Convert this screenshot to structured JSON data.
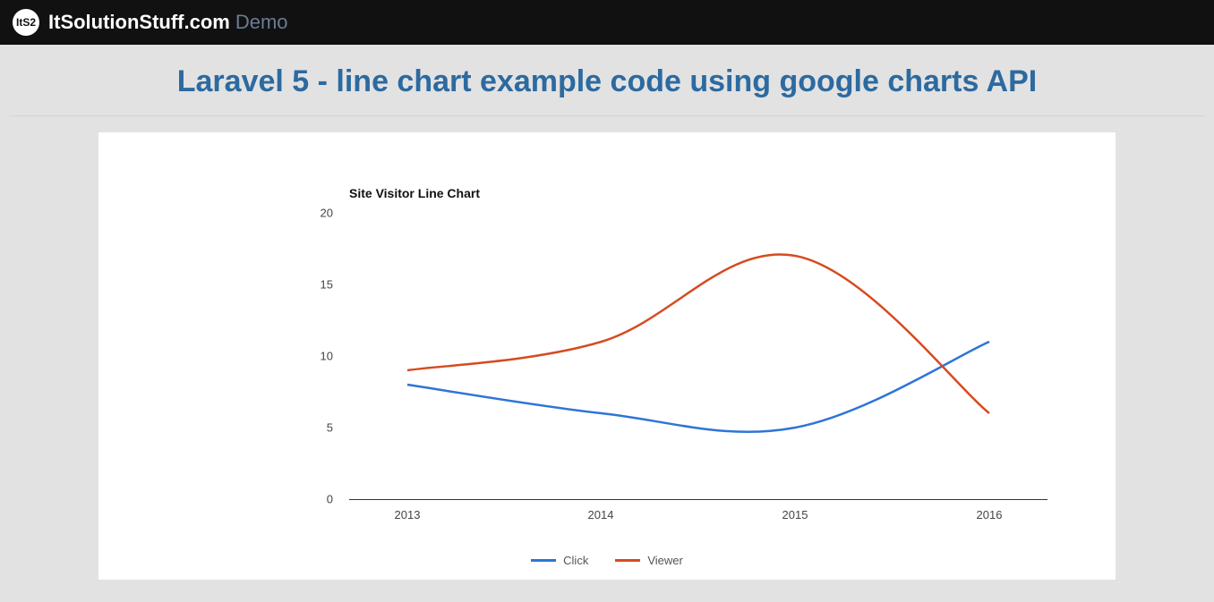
{
  "header": {
    "logo_abbr": "ItS2",
    "brand": "ItSolutionStuff.com",
    "demo": "Demo"
  },
  "page_title": "Laravel 5 - line chart example code using google charts API",
  "chart_data": {
    "type": "line",
    "title": "Site Visitor Line Chart",
    "categories": [
      "2013",
      "2014",
      "2015",
      "2016"
    ],
    "series": [
      {
        "name": "Click",
        "color": "#2e75d6",
        "values": [
          8,
          6,
          5,
          11
        ]
      },
      {
        "name": "Viewer",
        "color": "#d54b1f",
        "values": [
          9,
          11,
          17,
          6
        ]
      }
    ],
    "ylim": [
      0,
      20
    ],
    "yticks": [
      0,
      5,
      10,
      15,
      20
    ],
    "xlabel": "",
    "ylabel": ""
  }
}
